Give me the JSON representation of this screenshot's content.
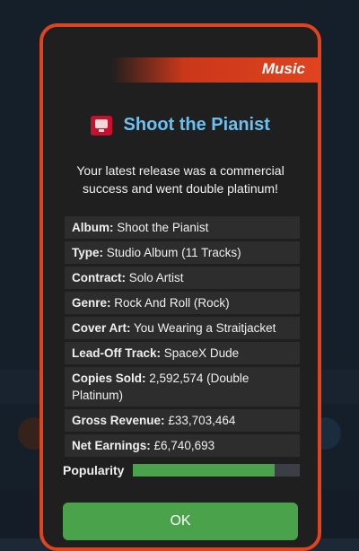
{
  "modal": {
    "category": "Music",
    "title": "Shoot the Pianist",
    "message": "Your latest release was a commercial success and went double platinum!",
    "details": [
      {
        "key": "Album:",
        "value": "Shoot the Pianist"
      },
      {
        "key": "Type:",
        "value": "Studio Album (11 Tracks)"
      },
      {
        "key": "Contract:",
        "value": "Solo Artist"
      },
      {
        "key": "Genre:",
        "value": "Rock And Roll (Rock)"
      },
      {
        "key": "Cover Art:",
        "value": "You Wearing a Straitjacket"
      },
      {
        "key": "Lead-Off Track:",
        "value": "SpaceX Dude"
      },
      {
        "key": "Copies Sold:",
        "value": "2,592,574 (Double Platinum)"
      },
      {
        "key": "Gross Revenue:",
        "value": "£33,703,464"
      },
      {
        "key": "Net Earnings:",
        "value": "£6,740,693"
      }
    ],
    "popularity_label": "Popularity",
    "popularity_level": 0.85,
    "ok_label": "OK"
  },
  "colors": {
    "accent": "#e0431e",
    "title": "#6cc0f0",
    "success": "#4aa34a"
  },
  "icons": {
    "title_icon": "album-cover-icon"
  }
}
